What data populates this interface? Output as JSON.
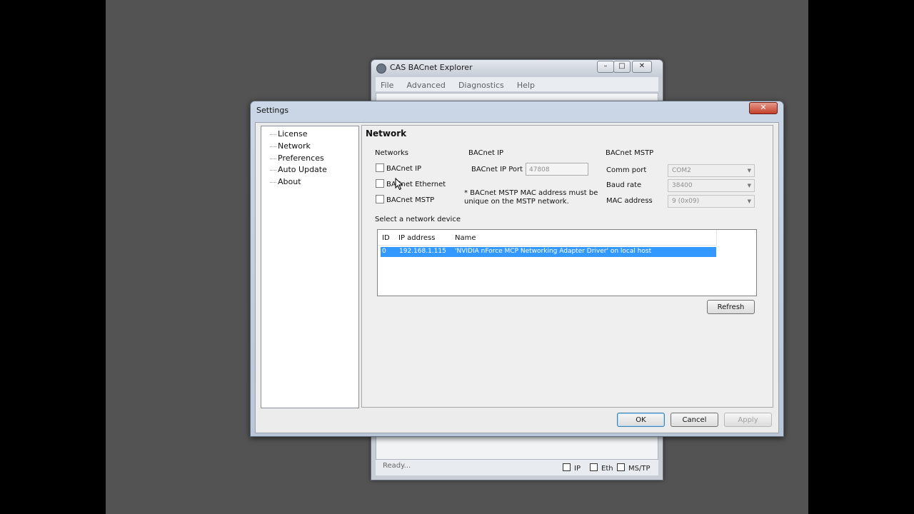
{
  "main_window": {
    "title": "CAS BACnet Explorer",
    "menu": [
      "File",
      "Advanced",
      "Diagnostics",
      "Help"
    ],
    "status": {
      "text": "Ready...",
      "indicators": [
        "IP",
        "Eth",
        "MS/TP"
      ]
    }
  },
  "dialog": {
    "title": "Settings",
    "close_glyph": "✕",
    "nav": [
      "License",
      "Network",
      "Preferences",
      "Auto Update",
      "About"
    ],
    "panel_title": "Network",
    "networks": {
      "label": "Networks",
      "options": [
        "BACnet IP",
        "BACnet Ethernet",
        "BACnet MSTP"
      ]
    },
    "bacnet_ip": {
      "label": "BACnet IP",
      "port_label": "BACnet IP Port",
      "port_value": "47808",
      "note": "* BACnet MSTP MAC address must be unique on the MSTP network."
    },
    "bacnet_mstp": {
      "label": "BACnet MSTP",
      "comm_port_label": "Comm port",
      "comm_port_value": "COM2",
      "baud_rate_label": "Baud rate",
      "baud_rate_value": "38400",
      "mac_address_label": "MAC address",
      "mac_address_value": "9  (0x09)"
    },
    "device_list": {
      "label": "Select a network device",
      "columns": [
        "ID",
        "IP address",
        "Name"
      ],
      "rows": [
        {
          "id": "0",
          "ip": "192.168.1.115",
          "name": "'NVIDIA nForce MCP Networking Adapter Driver' on local host"
        }
      ]
    },
    "buttons": {
      "refresh": "Refresh",
      "ok": "OK",
      "cancel": "Cancel",
      "apply": "Apply"
    }
  },
  "icons": {
    "arrow": "▼"
  }
}
